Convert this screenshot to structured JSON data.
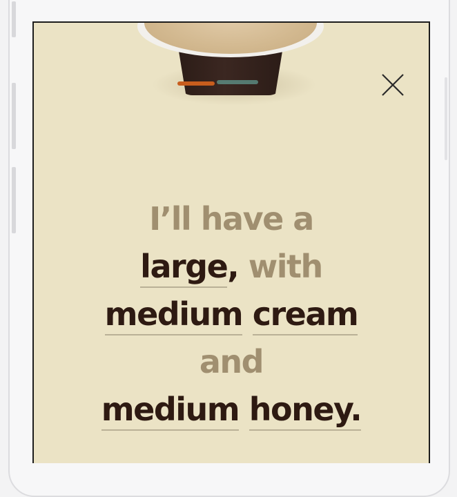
{
  "order": {
    "line1": "I’ll have a",
    "size_option": "large",
    "comma": ",",
    "with": "with",
    "cream_level": "medium",
    "cream_label": "cream",
    "and": "and",
    "honey_level": "medium",
    "honey_label": "honey",
    "period": "."
  },
  "icons": {
    "close": "close-icon",
    "cup": "coffee-cup-image"
  },
  "colors": {
    "background": "#ebe3c5",
    "accent_text": "#2e1a12",
    "muted_text": "#a08f70"
  }
}
